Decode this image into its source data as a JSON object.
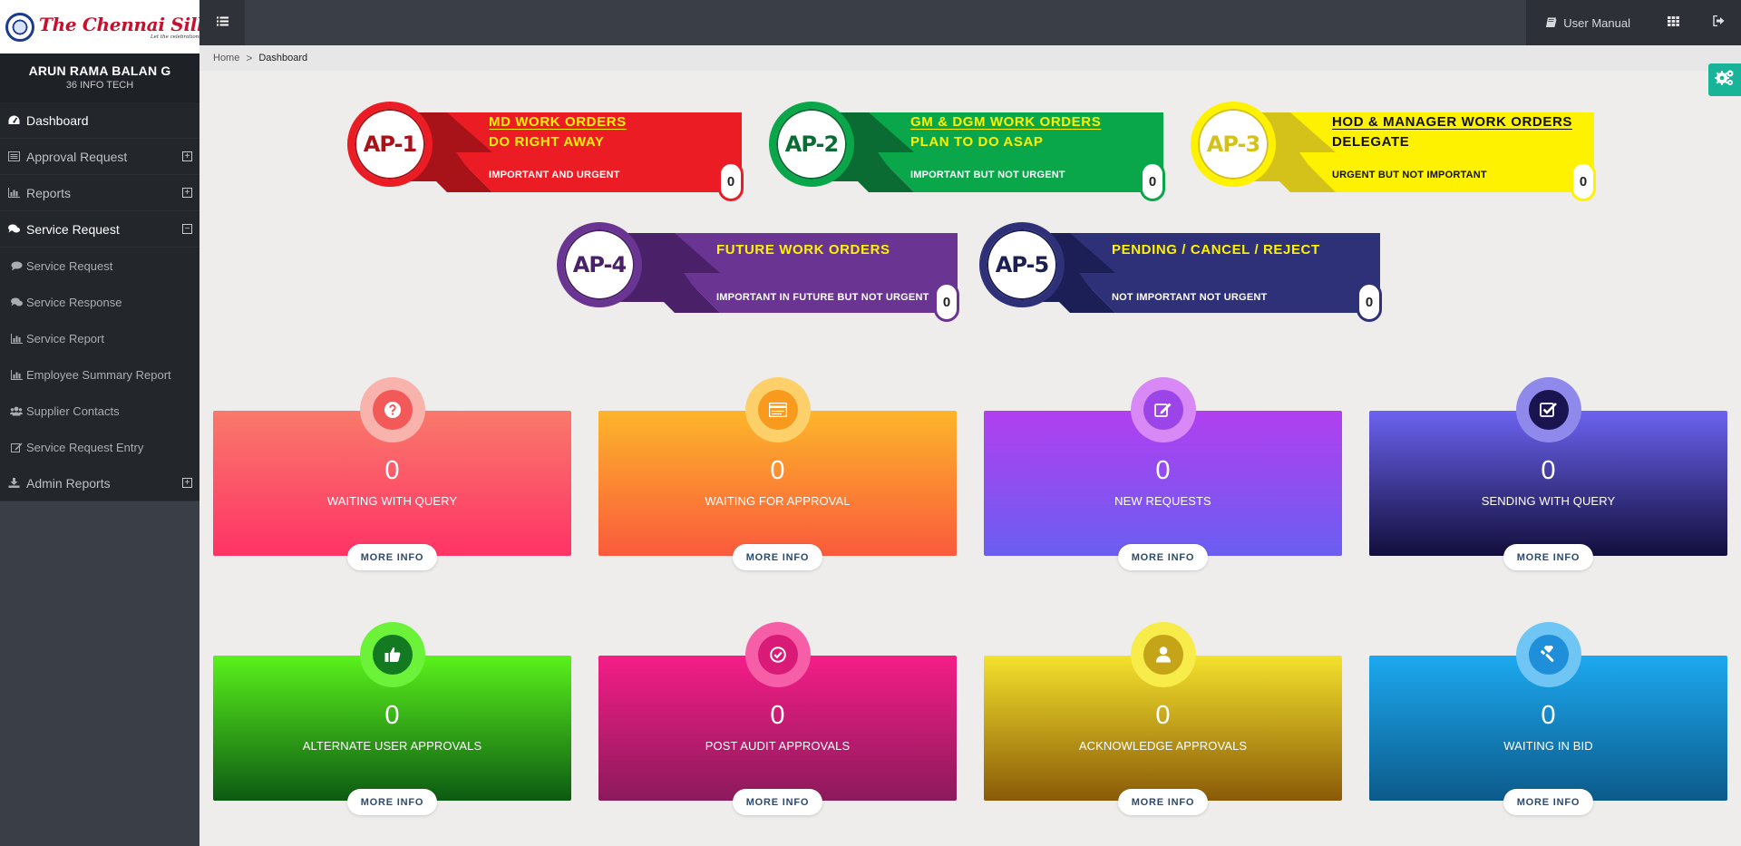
{
  "brand": {
    "logo_title": "The Chennai Silks",
    "logo_tagline": "Let the celebrations begin!"
  },
  "user": {
    "name": "ARUN RAMA BALAN G",
    "company": "36 INFO TECH"
  },
  "menu": [
    {
      "label": "Dashboard",
      "icon": "dashboard-icon"
    },
    {
      "label": "Approval Request",
      "icon": "list-icon",
      "toggle": "+"
    },
    {
      "label": "Reports",
      "icon": "bar-chart-icon",
      "toggle": "+"
    },
    {
      "label": "Service Request",
      "icon": "comments-icon",
      "toggle": "−"
    }
  ],
  "submenu": [
    {
      "label": "Service Request",
      "icon": "comment-icon"
    },
    {
      "label": "Service Response",
      "icon": "comments-icon"
    },
    {
      "label": "Service Report",
      "icon": "bar-chart-icon"
    },
    {
      "label": "Employee Summary Report",
      "icon": "bar-chart-icon"
    },
    {
      "label": "Supplier Contacts",
      "icon": "users-icon"
    },
    {
      "label": "Service Request Entry",
      "icon": "edit-icon"
    }
  ],
  "admin_menu": {
    "label": "Admin Reports",
    "icon": "download-icon",
    "toggle": "+"
  },
  "topbar": {
    "user_manual": "User Manual"
  },
  "breadcrumb": {
    "home": "Home",
    "separator": ">",
    "current": "Dashboard"
  },
  "ap_banners": [
    {
      "code": "AP-1",
      "line1": "MD WORK ORDERS",
      "line2": "DO RIGHT AWAY",
      "subtitle": "IMPORTANT AND URGENT",
      "count": "0",
      "color": "#ec1c24",
      "dark": "#a8131a",
      "title_color": "#fff200",
      "sub_color": "#ffffff"
    },
    {
      "code": "AP-2",
      "line1": "GM & DGM WORK ORDERS",
      "line2": "PLAN TO DO ASAP",
      "subtitle": "IMPORTANT BUT NOT URGENT",
      "count": "0",
      "color": "#0aa64a",
      "dark": "#0a6b33",
      "title_color": "#fff200",
      "sub_color": "#ffffff"
    },
    {
      "code": "AP-3",
      "line1": "HOD & MANAGER WORK ORDERS",
      "line2": "DELEGATE",
      "subtitle": "URGENT BUT NOT IMPORTANT",
      "count": "0",
      "color": "#fff200",
      "dark": "#d4c21a",
      "title_color": "#111111",
      "sub_color": "#111111"
    },
    {
      "code": "AP-4",
      "line1": "FUTURE WORK ORDERS",
      "line2": "",
      "subtitle": "IMPORTANT IN FUTURE BUT NOT URGENT",
      "count": "0",
      "color": "#6a3493",
      "dark": "#4a2169",
      "title_color": "#fff200",
      "sub_color": "#ffffff"
    },
    {
      "code": "AP-5",
      "line1": "PENDING / CANCEL / REJECT",
      "line2": "",
      "subtitle": "NOT IMPORTANT NOT URGENT",
      "count": "0",
      "color": "#2e3178",
      "dark": "#1c1f55",
      "title_color": "#fff200",
      "sub_color": "#ffffff"
    }
  ],
  "cards": [
    {
      "count": "0",
      "label": "WAITING WITH QUERY",
      "button": "MORE INFO",
      "icon": "question-icon",
      "grad_top": "#f9796b",
      "grad_bottom": "#ff3366",
      "ring": "#f9b3ad",
      "inner": "#f4595a"
    },
    {
      "count": "0",
      "label": "WAITING FOR APPROVAL",
      "button": "MORE INFO",
      "icon": "card-icon",
      "grad_top": "#fdb52a",
      "grad_bottom": "#fa5a3c",
      "ring": "#fdd06a",
      "inner": "#f89a1e"
    },
    {
      "count": "0",
      "label": "NEW REQUESTS",
      "button": "MORE INFO",
      "icon": "edit-icon",
      "grad_top": "#b13ff0",
      "grad_bottom": "#6a5ef0",
      "ring": "#d889f5",
      "inner": "#9b44e8"
    },
    {
      "count": "0",
      "label": "SENDING WITH QUERY",
      "button": "MORE INFO",
      "icon": "check-square-icon",
      "grad_top": "#6b63f0",
      "grad_bottom": "#120e3b",
      "ring": "#8f89ec",
      "inner": "#1a1550"
    },
    {
      "count": "0",
      "label": "ALTERNATE USER APPROVALS",
      "button": "MORE INFO",
      "icon": "thumbs-up-icon",
      "grad_top": "#5af21b",
      "grad_bottom": "#0c5a12",
      "ring": "#6df23a",
      "inner": "#137a22"
    },
    {
      "count": "0",
      "label": "POST AUDIT APPROVALS",
      "button": "MORE INFO",
      "icon": "check-circle-icon",
      "grad_top": "#f51d87",
      "grad_bottom": "#8c1a5b",
      "ring": "#f65fa7",
      "inner": "#d91a76"
    },
    {
      "count": "0",
      "label": "ACKNOWLEDGE APPROVALS",
      "button": "MORE INFO",
      "icon": "user-icon",
      "grad_top": "#f4e22c",
      "grad_bottom": "#8a5a08",
      "ring": "#f7ec49",
      "inner": "#c5a418"
    },
    {
      "count": "0",
      "label": "WAITING IN BID",
      "button": "MORE INFO",
      "icon": "gavel-icon",
      "grad_top": "#1ca9f0",
      "grad_bottom": "#0c5a8a",
      "ring": "#6fc6f5",
      "inner": "#1e8fd8"
    }
  ]
}
